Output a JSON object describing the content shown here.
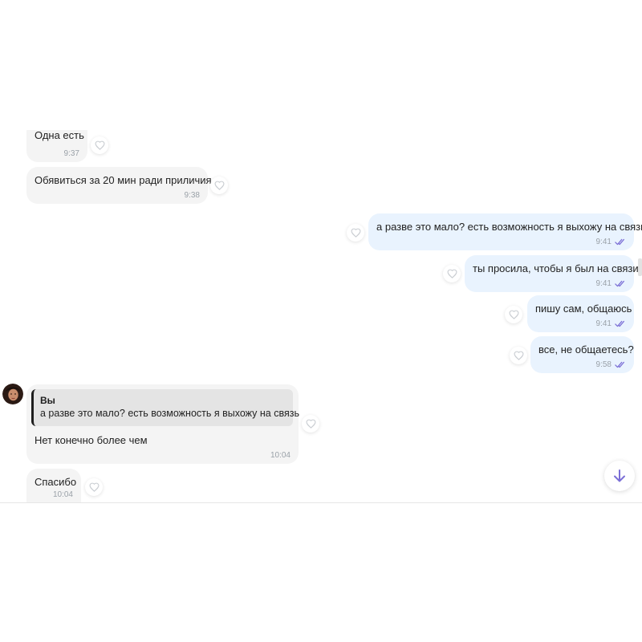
{
  "messages": [
    {
      "id": "m1",
      "direction": "in",
      "text": "Одна есть",
      "time": "9:37"
    },
    {
      "id": "m2",
      "direction": "in",
      "text": "Обявиться за 20 мин ради приличия",
      "time": "9:38"
    },
    {
      "id": "m3",
      "direction": "out",
      "text": "а разве это мало? есть возможность я выхожу на связь",
      "time": "9:41"
    },
    {
      "id": "m4",
      "direction": "out",
      "text": "ты просила, чтобы я был на связи",
      "time": "9:41"
    },
    {
      "id": "m5",
      "direction": "out",
      "text": "пишу сам, общаюсь",
      "time": "9:41"
    },
    {
      "id": "m6",
      "direction": "out",
      "text": "все, не общаетесь?",
      "time": "9:58"
    },
    {
      "id": "m7",
      "direction": "in",
      "quote": {
        "author": "Вы",
        "text": "а разве это мало? есть возможность я выхожу на связь"
      },
      "text": "Нет конечно более чем",
      "time": "10:04"
    },
    {
      "id": "m8",
      "direction": "in",
      "text": "Спасибо",
      "time": "10:04"
    }
  ],
  "icons": {
    "like": "heart-icon",
    "read": "double-check-icon",
    "scroll": "arrow-down-icon"
  },
  "colors": {
    "incoming_bubble": "#f4f4f4",
    "outgoing_bubble": "#e9f3fe",
    "accent": "#7b6fd6",
    "time_text": "#9aa1a8"
  }
}
